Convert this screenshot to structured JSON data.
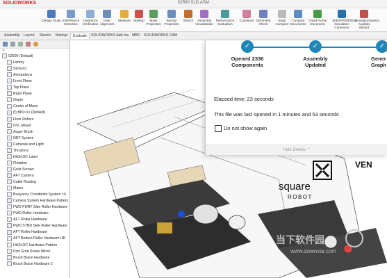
{
  "app": {
    "logo": "SOLIDWORKS",
    "document_title": "02500 SLD.ASM"
  },
  "ribbon": [
    {
      "label": "Design Study",
      "icon": "design-study-icon",
      "color": "#4a7bbf"
    },
    {
      "label": "Interference Detection",
      "icon": "interference-icon",
      "color": "#7a9ac8"
    },
    {
      "label": "Clearance Verification",
      "icon": "clearance-icon",
      "color": "#8fb0d6"
    },
    {
      "label": "Hole Alignment",
      "icon": "hole-alignment-icon",
      "color": "#6a8fba"
    },
    {
      "label": "Measure",
      "icon": "measure-icon",
      "color": "#e0b040"
    },
    {
      "label": "Markup",
      "icon": "markup-icon",
      "color": "#d05050"
    },
    {
      "label": "Mass Properties",
      "icon": "mass-properties-icon",
      "color": "#5c9c5c"
    },
    {
      "label": "Section Properties",
      "icon": "section-properties-icon",
      "color": "#6a8fba"
    },
    {
      "label": "Sensor",
      "icon": "sensor-icon",
      "color": "#c07030"
    },
    {
      "label": "Assembly Visualization",
      "icon": "assembly-visualization-icon",
      "color": "#a070c0"
    },
    {
      "label": "Performance Evaluation",
      "icon": "performance-icon",
      "color": "#4a9a9a"
    },
    {
      "label": "Curvature",
      "icon": "curvature-icon",
      "color": "#d080a0"
    },
    {
      "label": "Symmetry Check",
      "icon": "symmetry-icon",
      "color": "#7080c0"
    },
    {
      "label": "Body Compare",
      "icon": "body-compare-icon",
      "color": "#bbbbbb"
    },
    {
      "label": "Compare Documents",
      "icon": "compare-icon",
      "color": "#5c8cc0"
    },
    {
      "label": "Check Active Document",
      "icon": "check-icon",
      "color": "#4a9a4a"
    },
    {
      "label": "3DEXPERIENCE Simulation Connector",
      "icon": "simulation-connector-icon",
      "color": "#2a70a8"
    },
    {
      "label": "SimulationXpress Analysis Wizard",
      "icon": "simxpress-icon",
      "color": "#c05050"
    }
  ],
  "tabs": [
    "Assembly",
    "Layout",
    "Sketch",
    "Markup",
    "Evaluate",
    "SOLIDWORKS Add-Ins",
    "MBD",
    "SOLIDWORKS CAM"
  ],
  "active_tab": "Evaluate",
  "tree": {
    "filter_icon": "filter-icon",
    "items": [
      {
        "label": "02500 (Default)",
        "indent": 0
      },
      {
        "label": "History",
        "indent": 1
      },
      {
        "label": "Sensors",
        "indent": 1
      },
      {
        "label": "Annotations",
        "indent": 1
      },
      {
        "label": "Front Plane",
        "indent": 1
      },
      {
        "label": "Top Plane",
        "indent": 1
      },
      {
        "label": "Right Plane",
        "indent": 1
      },
      {
        "label": "Origin",
        "indent": 1
      },
      {
        "label": "Center of Mass",
        "indent": 1
      },
      {
        "label": "(f) B81<1> (Default)",
        "indent": 1
      },
      {
        "label": "Floor Rollers",
        "indent": 1
      },
      {
        "label": "DVL Mount",
        "indent": 1
      },
      {
        "label": "Auger Brush",
        "indent": 1
      },
      {
        "label": "NDT System",
        "indent": 1
      },
      {
        "label": "Cameras and Light",
        "indent": 1
      },
      {
        "label": "Thrusters",
        "indent": 1
      },
      {
        "label": "HAZLOC Label",
        "indent": 1
      },
      {
        "label": "Flotation",
        "indent": 1
      },
      {
        "label": "Grub Screws",
        "indent": 1
      },
      {
        "label": "AFT Camera",
        "indent": 1
      },
      {
        "label": "Cable Routing",
        "indent": 1
      },
      {
        "label": "Mates",
        "indent": 1
      },
      {
        "label": "Buoyancy Coordinate System <X",
        "indent": 1
      },
      {
        "label": "Camera System Hardware Pattern",
        "indent": 1
      },
      {
        "label": "FWD PORT Side Roller Hardware",
        "indent": 1
      },
      {
        "label": "FWD Roller Hardware",
        "indent": 1
      },
      {
        "label": "AFT Roller Hardware",
        "indent": 1
      },
      {
        "label": "FWD STBD Side Roller Hardware",
        "indent": 1
      },
      {
        "label": "AFT Roller Hardware",
        "indent": 1
      },
      {
        "label": "AFT Bottom Roller Hardware HD",
        "indent": 1
      },
      {
        "label": "HAZLOC Hardware Pattern",
        "indent": 1
      },
      {
        "label": "Port Grub Screw Mirror",
        "indent": 1
      },
      {
        "label": "Brush Brace Hardware",
        "indent": 1
      },
      {
        "label": "Brush Brace Hardware 2",
        "indent": 1
      }
    ]
  },
  "dialog": {
    "steps": [
      "Opened 2336 Components",
      "Assembly Updated",
      "Generating Graphics"
    ],
    "step_visible_labels": [
      "Opened 2336\nComponents",
      "Assembly\nUpdated",
      "Gener\nGraph"
    ],
    "elapsed": "Elapsed time: 23 seconds",
    "last_opened": "This file was last opened in 1 minutes and 53 seconds",
    "dont_show_label": "Do not show again",
    "hide_details": "Hide Details",
    "accent_color": "#1f86b8"
  },
  "model": {
    "brand_left": "square",
    "brand_right": "ROBOT",
    "brand_side": "VEN"
  },
  "watermark": {
    "text": "当下软件园",
    "url": "www.downxia.com"
  }
}
